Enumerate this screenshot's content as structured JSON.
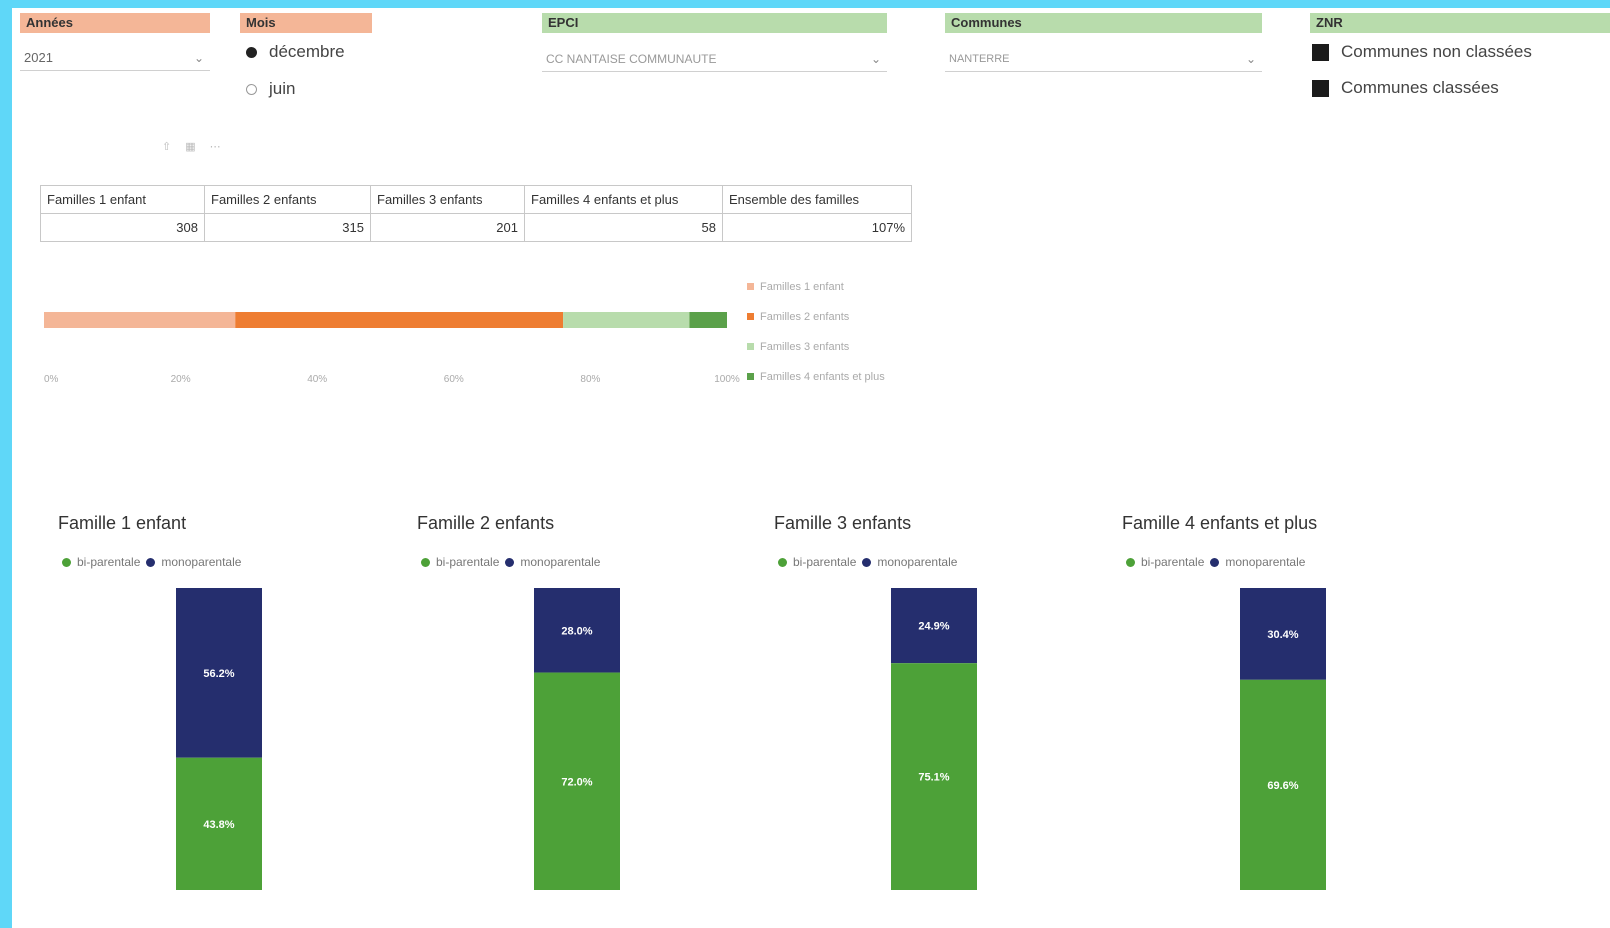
{
  "slicers": {
    "annees": {
      "header": "Années",
      "value": "2021"
    },
    "mois": {
      "header": "Mois",
      "options": [
        {
          "label": "décembre",
          "selected": true
        },
        {
          "label": "juin",
          "selected": false
        }
      ]
    },
    "epci": {
      "header": "EPCI",
      "value": "CC NANTAISE COMMUNAUTE"
    },
    "communes": {
      "header": "Communes",
      "value": "NANTERRE"
    },
    "znr": {
      "header": "ZNR",
      "options": [
        {
          "label": "Communes non classées"
        },
        {
          "label": "Communes classées"
        }
      ]
    }
  },
  "table": {
    "headers": [
      "Familles 1 enfant",
      "Familles 2 enfants",
      "Familles 3 enfants",
      "Familles 4 enfants et plus",
      "Ensemble des familles"
    ],
    "values": [
      "308",
      "315",
      "201",
      "58",
      "107%"
    ]
  },
  "colors": {
    "one_child": "#f4b697",
    "two_children": "#ee7d32",
    "three_children": "#b8dcac",
    "four_plus": "#5ba14a",
    "biparentale": "#4da138",
    "monoparentale": "#252e6e"
  },
  "chart_data": [
    {
      "type": "bar",
      "orientation": "horizontal-stacked-100",
      "series": [
        {
          "name": "Familles 1 enfant",
          "values": [
            28
          ]
        },
        {
          "name": "Familles 2 enfants",
          "values": [
            48
          ]
        },
        {
          "name": "Familles 3 enfants",
          "values": [
            18.5
          ]
        },
        {
          "name": "Familles 4 enfants et plus",
          "values": [
            5.5
          ]
        }
      ],
      "x_ticks": [
        "0%",
        "20%",
        "40%",
        "60%",
        "80%",
        "100%"
      ],
      "xlim": [
        0,
        100
      ],
      "legend": "right",
      "grid": false
    },
    {
      "type": "bar",
      "orientation": "vertical-stacked-100",
      "title": "Famille 1 enfant",
      "legend": [
        "bi-parentale",
        "monoparentale"
      ],
      "series": [
        {
          "name": "bi-parentale",
          "values": [
            43.8
          ]
        },
        {
          "name": "monoparentale",
          "values": [
            56.2
          ]
        }
      ],
      "labels": [
        "43.8%",
        "56.2%"
      ]
    },
    {
      "type": "bar",
      "orientation": "vertical-stacked-100",
      "title": "Famille 2 enfants",
      "legend": [
        "bi-parentale",
        "monoparentale"
      ],
      "series": [
        {
          "name": "bi-parentale",
          "values": [
            72.0
          ]
        },
        {
          "name": "monoparentale",
          "values": [
            28.0
          ]
        }
      ],
      "labels": [
        "72.0%",
        "28.0%"
      ]
    },
    {
      "type": "bar",
      "orientation": "vertical-stacked-100",
      "title": "Famille 3 enfants",
      "legend": [
        "bi-parentale",
        "monoparentale"
      ],
      "series": [
        {
          "name": "bi-parentale",
          "values": [
            75.1
          ]
        },
        {
          "name": "monoparentale",
          "values": [
            24.9
          ]
        }
      ],
      "labels": [
        "75.1%",
        "24.9%"
      ]
    },
    {
      "type": "bar",
      "orientation": "vertical-stacked-100",
      "title": "Famille 4 enfants et plus",
      "legend": [
        "bi-parentale",
        "monoparentale"
      ],
      "series": [
        {
          "name": "bi-parentale",
          "values": [
            69.6
          ]
        },
        {
          "name": "monoparentale",
          "values": [
            30.4
          ]
        }
      ],
      "labels": [
        "69.6%",
        "30.4%"
      ]
    }
  ]
}
